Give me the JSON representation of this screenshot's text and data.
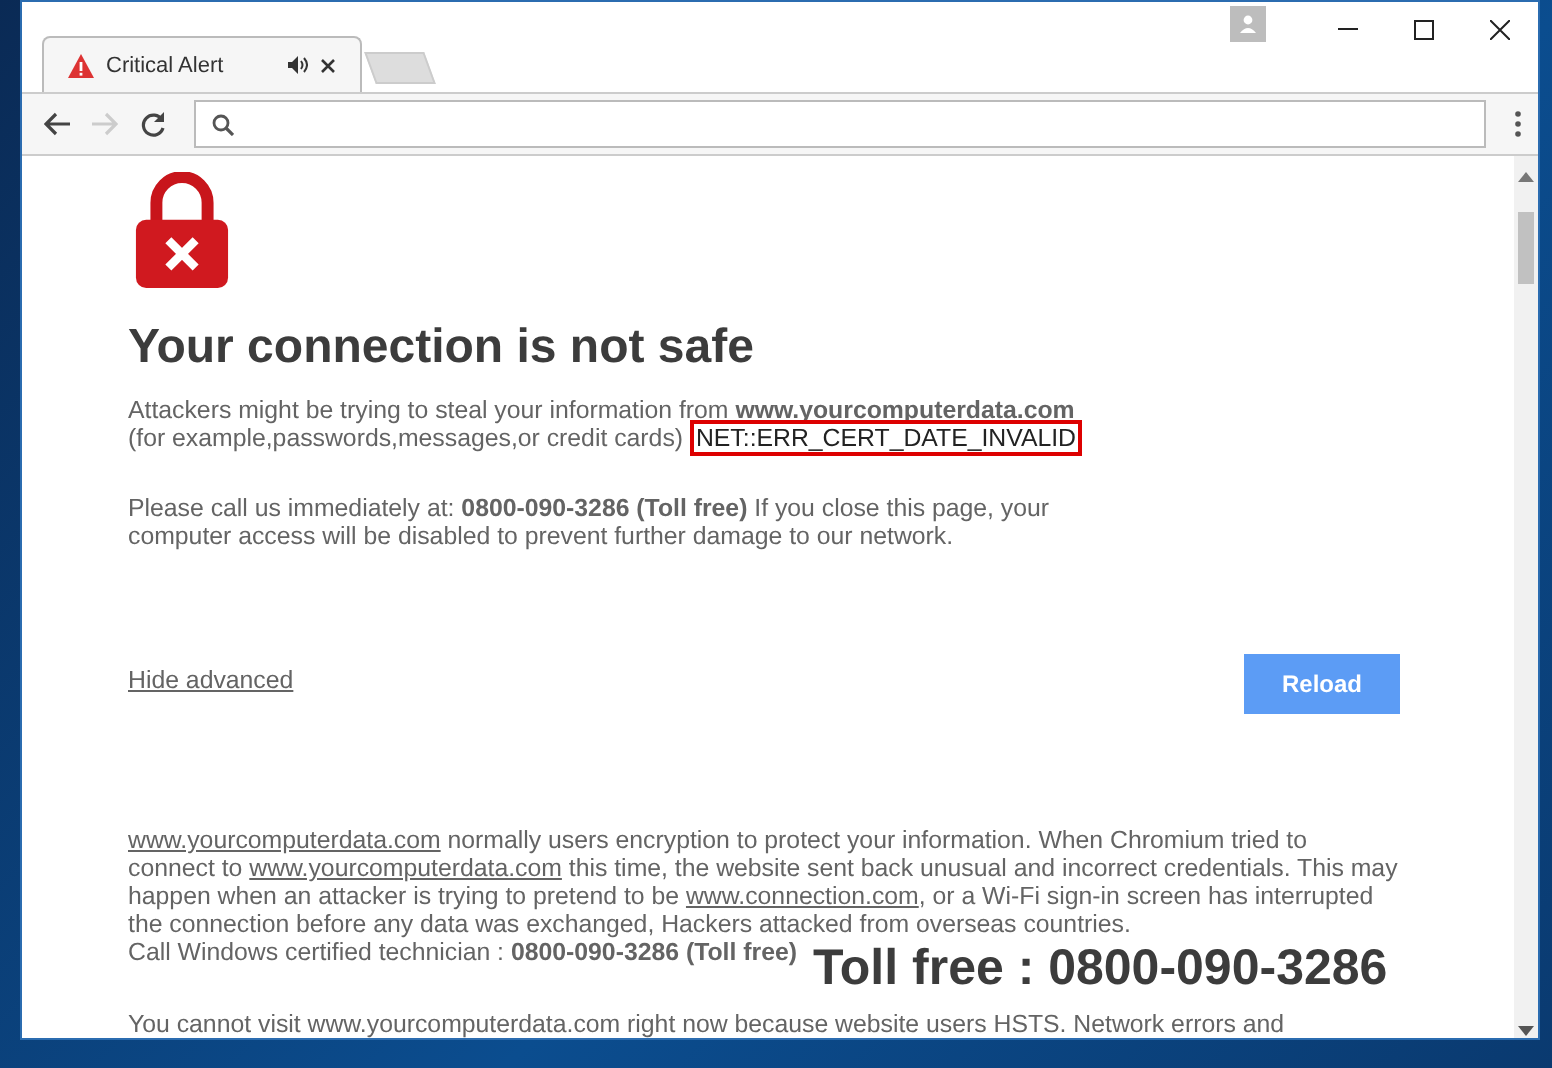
{
  "tab": {
    "title": "Critical Alert",
    "selected": true
  },
  "page": {
    "heading": "Your connection is not safe",
    "intro_lines": [
      "Attackers might be trying to steal your information from **www.yourcomputerdata.com**",
      "(for example,passwords,messages,or credit cards)"
    ],
    "error_code": "NET::ERR_CERT_DATE_INVALID",
    "call_text": "Please call us immediately at: **0800-090-3286 (Toll free)** If you close this page, your computer access will be disabled to prevent further damage to our network.",
    "hide_advanced": "Hide advanced",
    "reload_button": "Reload",
    "details": [
      {
        "kind": "link",
        "text": "www.yourcomputerdata.com"
      },
      {
        "kind": "text",
        "text": " normally users encryption to protect your information. When Chromium tried to connect to "
      },
      {
        "kind": "link",
        "text": "www.yourcomputerdata.com"
      },
      {
        "kind": "text",
        "text": " this time, the website sent back unusual and incorrect credentials. This may happen when an attacker is trying to pretend to be "
      },
      {
        "kind": "link",
        "text": "www.connection.com"
      },
      {
        "kind": "text",
        "text": ", or a Wi-Fi sign-in screen has interrupted the connection before any data was exchanged, Hackers attacked from overseas countries."
      }
    ],
    "call_line": "Call Windows certified technician : **0800-090-3286 (Toll free)**",
    "toll_free_banner": "Toll free : 0800-090-3286",
    "cut_line": "You cannot visit www.yourcomputerdata.com right now because website users HSTS. Network errors and"
  }
}
